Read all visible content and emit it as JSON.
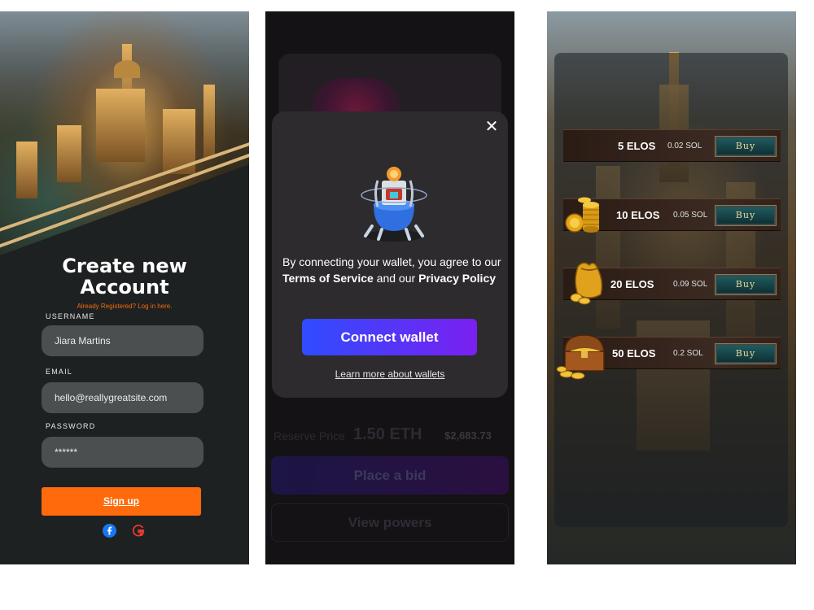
{
  "signup_screen": {
    "title_line1": "Create new",
    "title_line2": "Account",
    "already_registered": "Already Registered? Log in here.",
    "username": {
      "label": "USERNAME",
      "value": "Jiara Martins"
    },
    "email": {
      "label": "EMAIL",
      "value": "hello@reallygreatsite.com"
    },
    "password": {
      "label": "PASSWORD",
      "value": "******"
    },
    "signup_button": "Sign up",
    "social": [
      "facebook-icon",
      "google-icon"
    ],
    "accent_color": "#ff6a0c"
  },
  "wallet_screen": {
    "modal": {
      "close_glyph": "✕",
      "description_prefix": "By connecting your wallet, you agree to our ",
      "terms": "Terms of Service",
      "description_mid": " and our ",
      "privacy": "Privacy Policy",
      "connect_button": "Connect wallet",
      "learn_more": "Learn more about wallets"
    },
    "background": {
      "reserve_label": "Reserve Price",
      "reserve_eth": "1.50 ETH",
      "reserve_usd": "$2,683.73",
      "bid_button": "Place a bid",
      "powers_button": "View powers"
    }
  },
  "shop_screen": {
    "items": [
      {
        "amount": "5 ELOS",
        "price": "0.02 SOL",
        "buy": "Buy",
        "icon": "none"
      },
      {
        "amount": "10 ELOS",
        "price": "0.05 SOL",
        "buy": "Buy",
        "icon": "coin-stack-icon"
      },
      {
        "amount": "20 ELOS",
        "price": "0.09 SOL",
        "buy": "Buy",
        "icon": "coin-bag-icon"
      },
      {
        "amount": "50 ELOS",
        "price": "0.2 SOL",
        "buy": "Buy",
        "icon": "treasure-chest-icon"
      }
    ]
  }
}
